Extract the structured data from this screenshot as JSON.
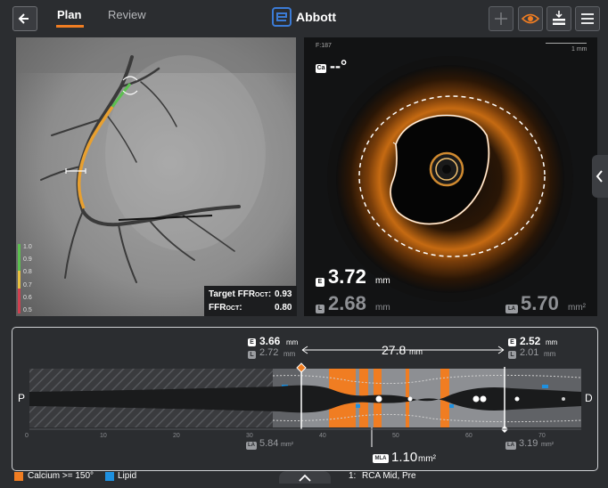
{
  "header": {
    "tabs": [
      {
        "label": "Plan",
        "active": true
      },
      {
        "label": "Review",
        "active": false
      }
    ],
    "brand": "Abbott",
    "accent_color": "#f07d22"
  },
  "angio": {
    "scale": [
      "1.0",
      "0.9",
      "0.8",
      "0.7",
      "0.6",
      "0.5"
    ],
    "target_ffr_label": "Target FFR",
    "target_ffr_sub": "OCT",
    "target_ffr_value": "0.93",
    "ffr_label": "FFR",
    "ffr_sub": "OCT",
    "ffr_value": "0.80"
  },
  "oct": {
    "frame": "F:187",
    "scale_label": "1 mm",
    "ca_badge": "Ca",
    "angle": "--°",
    "e_badge": "E",
    "l_badge": "L",
    "la_badge": "LA",
    "e_value": "3.72",
    "e_unit": "mm",
    "l_value": "2.68",
    "l_unit": "mm",
    "la_value": "5.70",
    "la_unit": "mm²"
  },
  "longitudinal": {
    "left_e": "3.66",
    "left_e_unit": "mm",
    "left_l": "2.72",
    "left_l_unit": "mm",
    "length": "27.8",
    "length_unit": "mm",
    "right_e": "2.52",
    "right_e_unit": "mm",
    "right_l": "2.01",
    "right_l_unit": "mm",
    "left_la": "5.84",
    "left_la_unit": "mm²",
    "right_la": "3.19",
    "right_la_unit": "mm²",
    "mla_badge": "MLA",
    "mla_value": "1.10",
    "mla_unit": "mm²",
    "proximal": "P",
    "distal": "D",
    "ticks": [
      "0",
      "10",
      "20",
      "30",
      "40",
      "50",
      "60",
      "70"
    ]
  },
  "legend": {
    "calcium": "Calcium >= 150°",
    "calcium_color": "#f07d22",
    "lipid": "Lipid",
    "lipid_color": "#1e90e0",
    "run_index": "1:",
    "run_label": "RCA Mid, Pre"
  }
}
